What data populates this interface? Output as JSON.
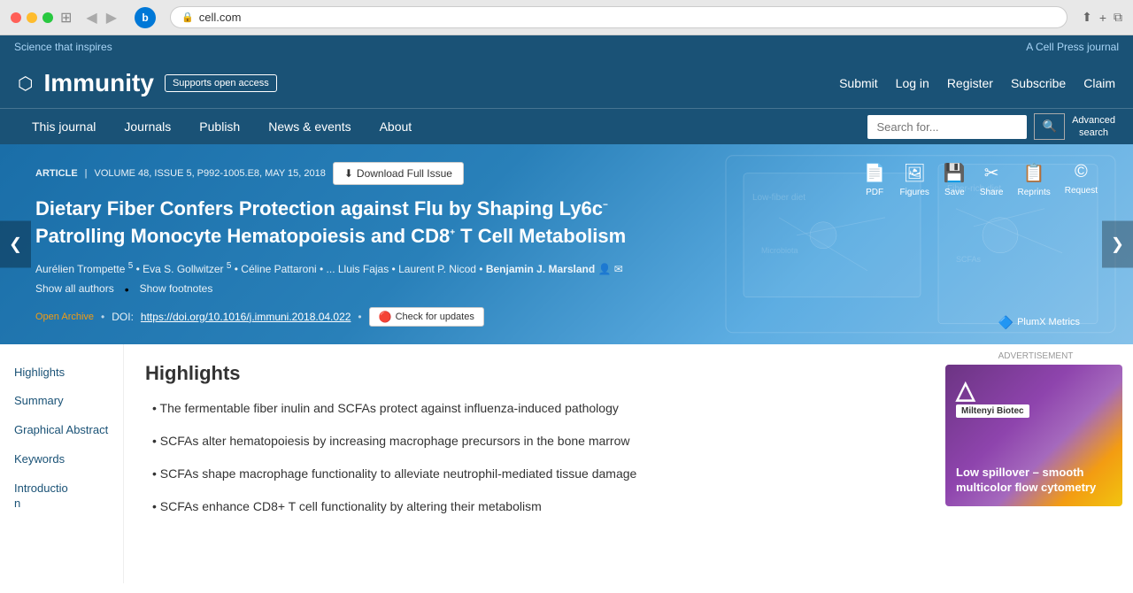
{
  "browser": {
    "url": "cell.com",
    "back_icon": "◀",
    "forward_icon": "▶",
    "bing_label": "b",
    "share_icon": "⬆",
    "add_tab_icon": "+",
    "tabs_icon": "⧉"
  },
  "top_bar": {
    "left_text": "Science that inspires",
    "right_text": "A Cell Press journal"
  },
  "header": {
    "logo_icon": "⬡",
    "logo_text": "Immunity",
    "open_access_badge": "Supports open access",
    "submit": "Submit",
    "login": "Log in",
    "register": "Register",
    "subscribe": "Subscribe",
    "claim": "Claim"
  },
  "nav": {
    "items": [
      {
        "label": "This journal"
      },
      {
        "label": "Journals"
      },
      {
        "label": "Publish"
      },
      {
        "label": "News & events"
      },
      {
        "label": "About"
      }
    ],
    "search_placeholder": "Search for...",
    "search_button": "🔍",
    "advanced_search": "Advanced\nsearch"
  },
  "article": {
    "label": "ARTICLE",
    "volume_info": "VOLUME 48, ISSUE 5, P992-1005.E8, MAY 15, 2018",
    "download_btn": "Download Full Issue",
    "title_line1": "Dietary Fiber Confers Protection against Flu by Shaping Ly6c",
    "title_sup": "−",
    "title_line2": "Patrolling Monocyte Hematopoiesis and CD8",
    "title_sup2": "+",
    "title_line3": " T Cell Metabolism",
    "authors": "Aurélien Trompette • Eva S. Gollwitzer • Céline Pattaroni • ... Lluis Fajas • Laurent P. Nicod • Benjamin J. Marsland",
    "show_authors": "Show all authors",
    "show_footnotes": "Show footnotes",
    "open_archive": "Open Archive",
    "doi_label": "DOI:",
    "doi_link": "https://doi.org/10.1016/j.immuni.2018.04.022",
    "check_updates": "Check for updates",
    "plumx": "PlumX Metrics",
    "actions": [
      {
        "icon": "📄",
        "label": "PDF"
      },
      {
        "icon": "🖼",
        "label": "Figures"
      },
      {
        "icon": "💾",
        "label": "Save"
      },
      {
        "icon": "✂",
        "label": "Share"
      },
      {
        "icon": "📋",
        "label": "Reprints"
      },
      {
        "icon": "©",
        "label": "Request"
      }
    ]
  },
  "sidebar": {
    "items": [
      {
        "label": "Highlights"
      },
      {
        "label": "Summary"
      },
      {
        "label": "Graphical Abstract"
      },
      {
        "label": "Keywords"
      },
      {
        "label": "Introduction"
      }
    ]
  },
  "highlights": {
    "section_title": "Highlights",
    "items": [
      "• The fermentable fiber inulin and SCFAs protect against influenza-induced pathology",
      "• SCFAs alter hematopoiesis by increasing macrophage precursors in the bone marrow",
      "• SCFAs shape macrophage functionality to alleviate neutrophil-mediated tissue damage",
      "• SCFAs enhance CD8+ T cell functionality by altering their metabolism"
    ]
  },
  "ad": {
    "label": "ADVERTISEMENT",
    "company": "Miltenyi Biotec",
    "headline": "Low spillover – smooth multicolor flow cytometry"
  },
  "banner_prev": "❮",
  "banner_next": "❯"
}
